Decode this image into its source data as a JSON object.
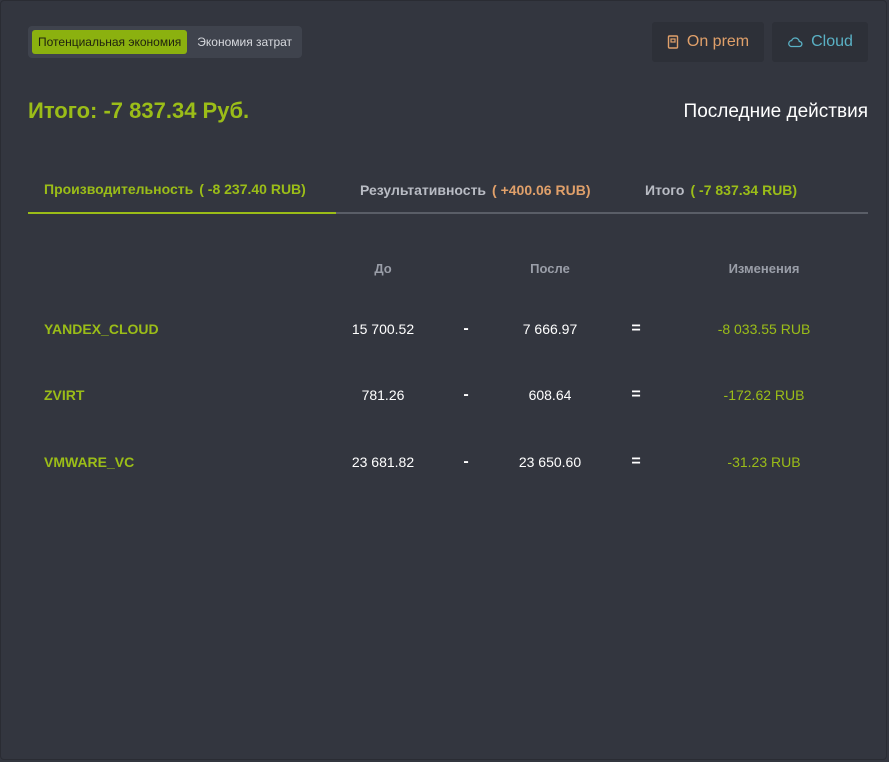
{
  "mode_toggle": {
    "options": [
      "Потенциальная экономия",
      "Экономия затрат"
    ],
    "active": 0
  },
  "env_buttons": {
    "onprem": "On prem",
    "cloud": "Cloud"
  },
  "total_label": "Итого: -7 837.34 Руб.",
  "recent_actions": "Последние действия",
  "tabs": [
    {
      "label": "Производительность",
      "value": "( -8 237.40 RUB)"
    },
    {
      "label": "Результативность",
      "value": "( +400.06 RUB)"
    },
    {
      "label": "Итого",
      "value": "( -7 837.34 RUB)"
    }
  ],
  "table": {
    "headers": {
      "before": "До",
      "after": "После",
      "change": "Изменения"
    },
    "minus": "-",
    "equals": "=",
    "rows": [
      {
        "name": "YANDEX_CLOUD",
        "before": "15 700.52",
        "after": "7 666.97",
        "change": "-8 033.55 RUB"
      },
      {
        "name": "ZVIRT",
        "before": "781.26",
        "after": "608.64",
        "change": "-172.62 RUB"
      },
      {
        "name": "VMWARE_VC",
        "before": "23 681.82",
        "after": "23 650.60",
        "change": "-31.23 RUB"
      }
    ]
  },
  "colors": {
    "accent": "#9bbd18",
    "onprem": "#e0a06a",
    "cloud": "#5ab1c5",
    "background": "#33363f"
  }
}
